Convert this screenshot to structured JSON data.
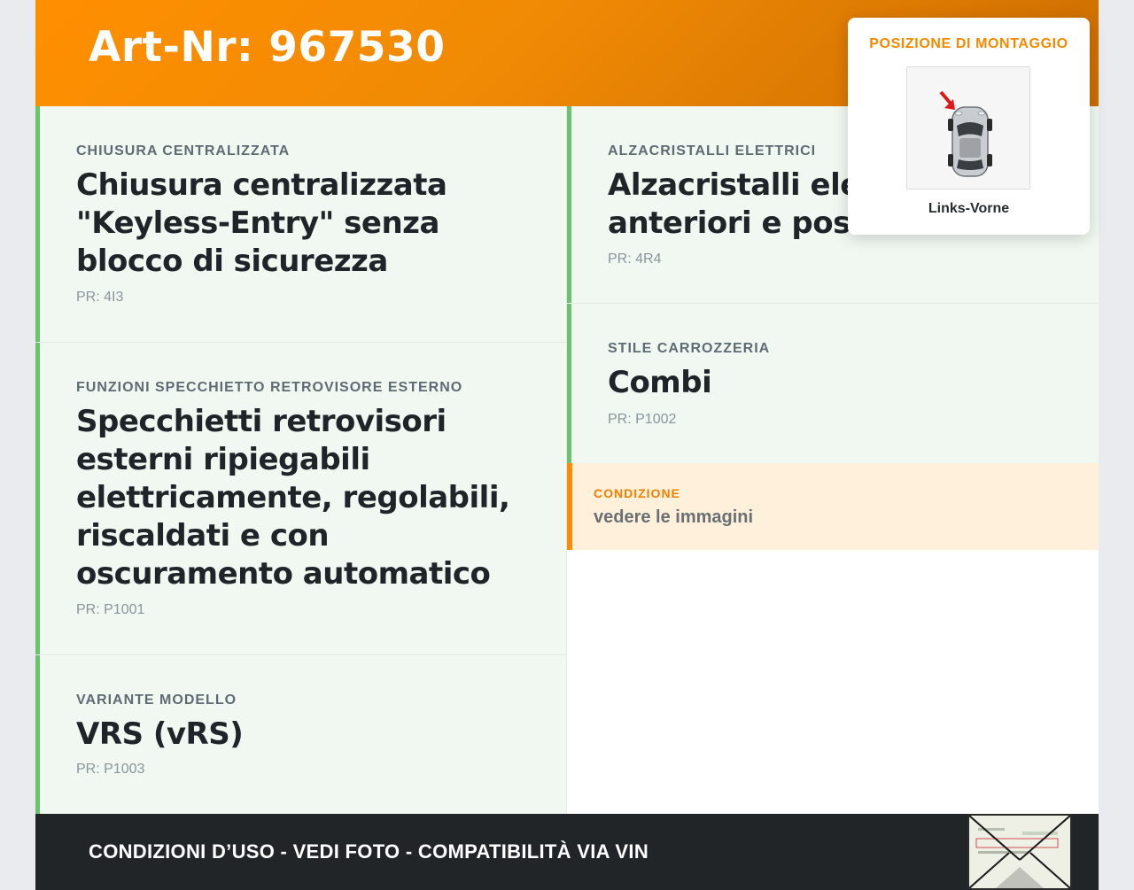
{
  "header": {
    "title": "Art-Nr: 967530"
  },
  "cards": [
    {
      "label": "CHIUSURA CENTRALIZZATA",
      "value": "Chiusura centralizzata \"Keyless-Entry\" senza blocco di sicurezza",
      "pr": "PR: 4I3"
    },
    {
      "label": "FUNZIONI SPECCHIETTO RETROVISORE ESTERNO",
      "value": "Specchietti retrovisori esterni ripiegabili elettricamente, regolabili, riscaldati e con oscuramento automatico",
      "pr": "PR: P1001"
    },
    {
      "label": "VARIANTE MODELLO",
      "value": "VRS (vRS)",
      "pr": "PR: P1003"
    },
    {
      "label": "ALZACRISTALLI ELETTRICI",
      "value": "Alzacristalli elettrici anteriori e posteriori",
      "pr": "PR: 4R4"
    },
    {
      "label": "STILE CARROZZERIA",
      "value": "Combi",
      "pr": "PR: P1002"
    }
  ],
  "condition": {
    "label": "CONDIZIONE",
    "value": "vedere le immagini"
  },
  "popover": {
    "title": "POSIZIONE DI MONTAGGIO",
    "position": "Links-Vorne",
    "icon": "car-top-view-icon"
  },
  "footer": {
    "text": "CONDIZIONI D’USO - VEDI FOTO - COMPATIBILITÀ VIA VIN",
    "icon": "envelope-icon"
  },
  "colors": {
    "accent": "#ff8c00",
    "card_border": "#6cc16c",
    "card_bg": "#f1f8f1",
    "footer_bg": "#222528"
  }
}
